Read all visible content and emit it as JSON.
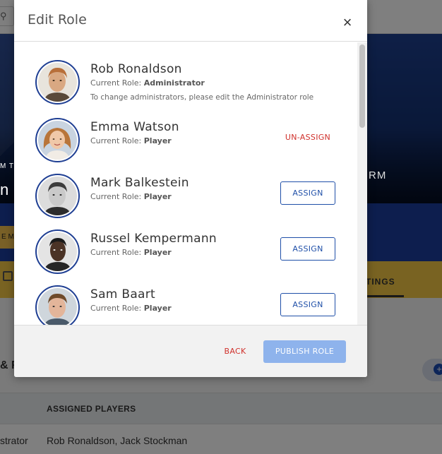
{
  "background": {
    "hero_subtitle": "M TE",
    "hero_title": "n",
    "hero_right_text": "RM",
    "yellow_button": "E MA",
    "tab_settings": "TINGS",
    "section_title": "& F",
    "table_header": "ASSIGNED PLAYERS",
    "table_row": {
      "role": "strator",
      "players": "Rob Ronaldson, Jack Stockman"
    }
  },
  "modal": {
    "title": "Edit Role",
    "close_symbol": "×",
    "role_prefix": "Current Role:",
    "users": [
      {
        "name": "Rob Ronaldson",
        "role": "Administrator",
        "note": "To change administrators, please edit the Administrator role",
        "action": ""
      },
      {
        "name": "Emma Watson",
        "role": "Player",
        "action": "UN-ASSIGN"
      },
      {
        "name": "Mark Balkestein",
        "role": "Player",
        "action": "ASSIGN"
      },
      {
        "name": "Russel Kempermann",
        "role": "Player",
        "action": "ASSIGN"
      },
      {
        "name": "Sam Baart",
        "role": "Player",
        "action": "ASSIGN"
      }
    ],
    "footer": {
      "back_label": "BACK",
      "publish_label": "PUBLISH ROLE"
    }
  },
  "colors": {
    "primary": "#1f4fa8",
    "danger": "#d0302b",
    "publish_disabled": "#8eb3ec",
    "avatar_ring": "#1f3f93"
  }
}
